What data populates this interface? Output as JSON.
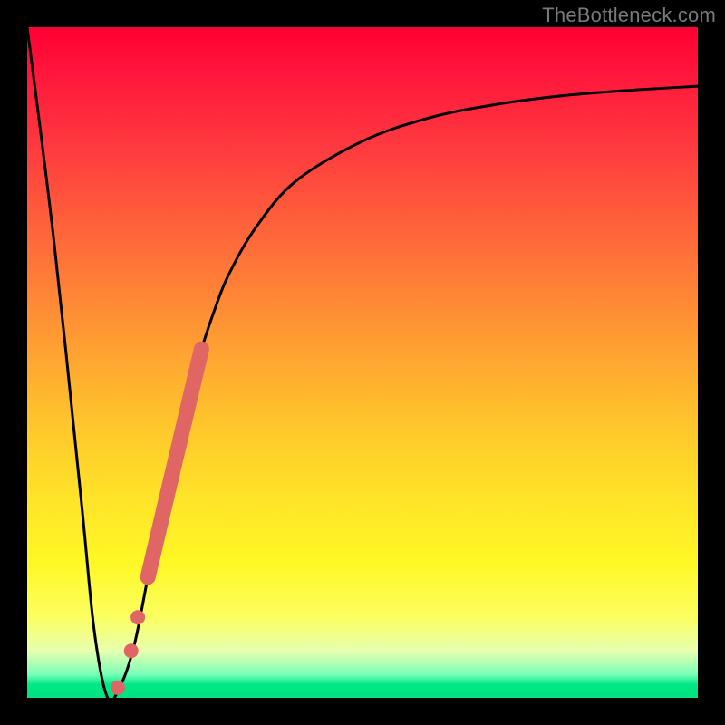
{
  "watermark": "TheBottleneck.com",
  "colors": {
    "frame": "#000000",
    "curve": "#000000",
    "series_dots": "#e06666",
    "gradient_top": "#ff0033",
    "gradient_bottom": "#00e37f"
  },
  "chart_data": {
    "type": "line",
    "title": "",
    "xlabel": "",
    "ylabel": "",
    "xlim": [
      0,
      100
    ],
    "ylim": [
      0,
      100
    ],
    "curve": {
      "description": "Bottleneck percentage vs relative component performance; V-shaped dip near x≈12 then asymptotic rise toward ~90%.",
      "x": [
        0,
        4,
        8,
        10,
        12,
        14,
        16,
        18,
        20,
        22,
        24,
        26,
        28,
        30,
        34,
        40,
        50,
        60,
        70,
        80,
        90,
        100
      ],
      "y": [
        100,
        68,
        30,
        10,
        0,
        2,
        8,
        18,
        28,
        37,
        45,
        52,
        58,
        63,
        70,
        77,
        83,
        86.5,
        88.5,
        89.8,
        90.6,
        91.2
      ]
    },
    "series": [
      {
        "name": "highlighted-range",
        "style": "thick-segment",
        "color": "#e06666",
        "x_range": [
          18,
          26
        ],
        "y_range": [
          18,
          52
        ]
      },
      {
        "name": "dot-1",
        "style": "dot",
        "color": "#e06666",
        "x": 16.5,
        "y": 12
      },
      {
        "name": "dot-2",
        "style": "dot",
        "color": "#e06666",
        "x": 15.5,
        "y": 7
      },
      {
        "name": "dot-3",
        "style": "dot",
        "color": "#e06666",
        "x": 13.5,
        "y": 1.5
      }
    ]
  }
}
